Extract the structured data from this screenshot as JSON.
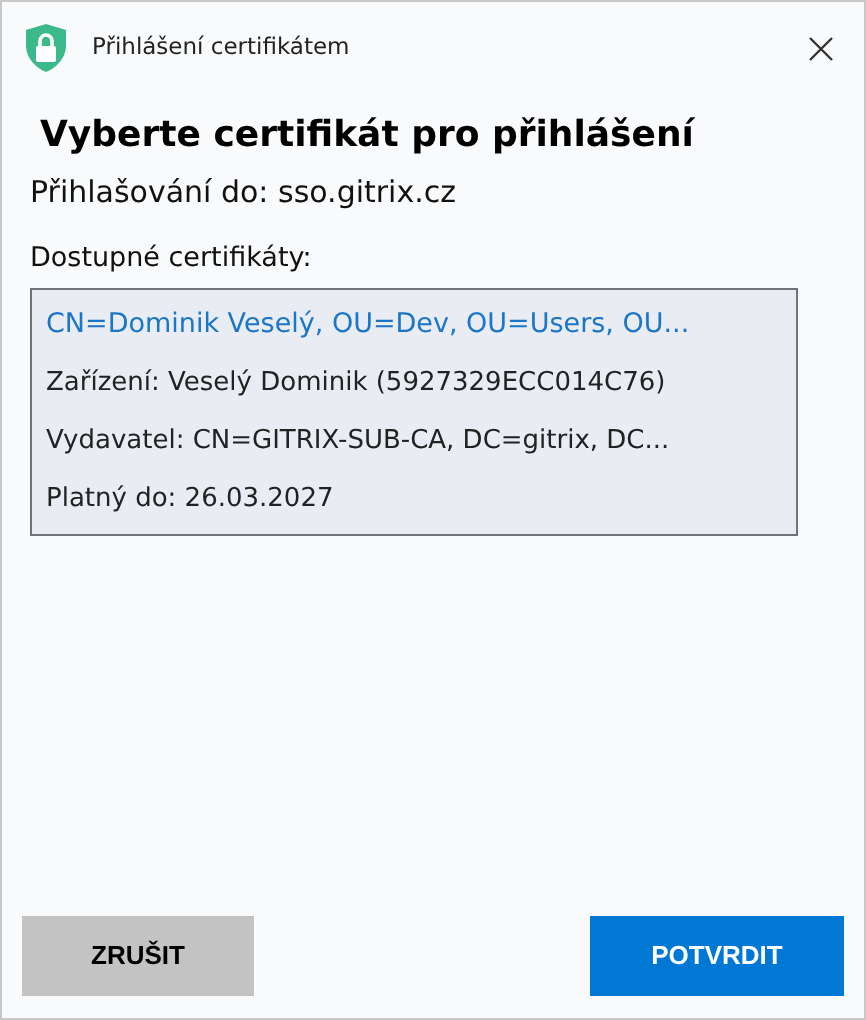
{
  "window": {
    "title": "Přihlášení certifikátem"
  },
  "heading": "Vyberte certifikát pro přihlášení",
  "target": "Přihlašování do: sso.gitrix.cz",
  "list_label": "Dostupné certifikáty:",
  "certificates": [
    {
      "subject": "CN=Dominik Veselý, OU=Dev, OU=Users, OU...",
      "device": "Zařízení: Veselý Dominik (5927329ECC014C76)",
      "issuer": "Vydavatel: CN=GITRIX-SUB-CA, DC=gitrix, DC...",
      "valid": "Platný do: 26.03.2027",
      "selected": true
    }
  ],
  "buttons": [
    {
      "label": "ZRUŠIT",
      "kind": "secondary"
    },
    {
      "label": "POTVRDIT",
      "kind": "primary"
    }
  ]
}
